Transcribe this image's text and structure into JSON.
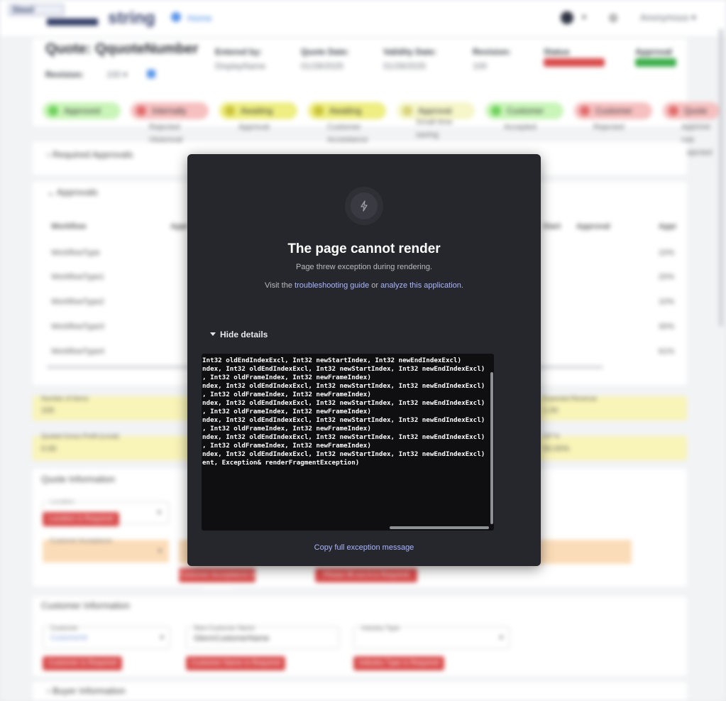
{
  "background": {
    "logo_text": "Steel",
    "brand": "string",
    "home_label": "Home",
    "user_label": "Anonymous",
    "quote_title": "Quote: QquoteNumber",
    "revision_label": "Revision:",
    "revision_value": "100",
    "fields": [
      {
        "label": "Entered by:",
        "value": "DisplayName"
      },
      {
        "label": "Quote Date:",
        "value": "01/28/2025"
      },
      {
        "label": "Validity Date:",
        "value": "01/28/2025"
      },
      {
        "label": "Revision:",
        "value": "100"
      },
      {
        "label": "Status",
        "value": ""
      },
      {
        "label": "Approval",
        "value": ""
      }
    ],
    "pills": [
      {
        "label": "Approved",
        "sub": "",
        "color": "#c9f5b8",
        "dot": "#6fcf5c"
      },
      {
        "label": "Internally",
        "sub": "Rejected (Approval Required)",
        "color": "#f7c0c0",
        "dot": "#e06a6a"
      },
      {
        "label": "Awaiting",
        "sub": "Approval",
        "color": "#eeee82",
        "dot": "#c9c23a"
      },
      {
        "label": "Awaiting",
        "sub": "Customer Acceptance",
        "color": "#eeee82",
        "dot": "#c9c23a"
      },
      {
        "label": "Approval",
        "sub": "Small time saving",
        "color": "#f6f6c9",
        "dot": "#d6d27a"
      },
      {
        "label": "Customer",
        "sub": "Accepted",
        "color": "#c9f5b8",
        "dot": "#6fcf5c"
      },
      {
        "label": "Customer",
        "sub": "Rejected",
        "color": "#f7c0c0",
        "dot": "#e06a6a"
      },
      {
        "label": "Quote",
        "sub": "Approve rule Rejected",
        "color": "#f7c0c0",
        "dot": "#e06a6a"
      }
    ],
    "sections": {
      "required_approvals": "Required Approvals",
      "approvals": "Approvals",
      "quote_information": "Quote Information",
      "customer_information": "Customer Information",
      "buyer_information": "Buyer Information"
    },
    "table": {
      "headers": [
        "Workflow",
        "Appr",
        "",
        "Start",
        "Approval",
        "Appr"
      ],
      "rows": [
        {
          "workflow": "WorkflowType",
          "right": "10%"
        },
        {
          "workflow": "WorkflowType1",
          "right": "20%"
        },
        {
          "workflow": "WorkflowType2",
          "right": "10%"
        },
        {
          "workflow": "WorkflowType3",
          "right": "30%"
        },
        {
          "workflow": "WorkflowType4",
          "right": "61%"
        }
      ]
    },
    "metrics": [
      {
        "label": "Number of Items",
        "value": "100"
      },
      {
        "label": "Expected Revenue",
        "value": "1.00"
      },
      {
        "label": "Quoted Gross Profit (Local)",
        "value": "0.00"
      },
      {
        "label": "GP %",
        "value": "50.00%"
      }
    ],
    "quote_info_fields": {
      "location_label": "Location",
      "acceptance_label": "Customer Acceptance"
    },
    "customer_fields": {
      "customer_label": "Customer",
      "customer_value": "CustomerId",
      "customer_name_label": "New Customer Name",
      "customer_name_value": "GlennCustomerName",
      "industry_label": "Industry Type"
    },
    "required_buttons": {
      "location": "Location is Required",
      "acceptance": "Customer Acceptance is Required",
      "ab": "Please fill out A is Required",
      "customer": "Customer is Required",
      "customer_name": "Customer Name is Required",
      "industry": "Industry Type is Required"
    }
  },
  "modal": {
    "title": "The page cannot render",
    "subtitle": "Page threw exception during rendering.",
    "links_prefix": "Visit the ",
    "link_troubleshooting": "troubleshooting guide",
    "links_middle": " or ",
    "link_analyze": "analyze this application",
    "links_suffix": ".",
    "hide_details": "Hide details",
    "stack_trace": "Int32 oldEndIndexExcl, Int32 newStartIndex, Int32 newEndIndexExcl)\nndex, Int32 oldEndIndexExcl, Int32 newStartIndex, Int32 newEndIndexExcl)\n, Int32 oldFrameIndex, Int32 newFrameIndex)\nndex, Int32 oldEndIndexExcl, Int32 newStartIndex, Int32 newEndIndexExcl)\n, Int32 oldFrameIndex, Int32 newFrameIndex)\nndex, Int32 oldEndIndexExcl, Int32 newStartIndex, Int32 newEndIndexExcl)\n, Int32 oldFrameIndex, Int32 newFrameIndex)\nndex, Int32 oldEndIndexExcl, Int32 newStartIndex, Int32 newEndIndexExcl)\n, Int32 oldFrameIndex, Int32 newFrameIndex)\nndex, Int32 oldEndIndexExcl, Int32 newStartIndex, Int32 newEndIndexExcl)\n, Int32 oldFrameIndex, Int32 newFrameIndex)\nndex, Int32 oldEndIndexExcl, Int32 newStartIndex, Int32 newEndIndexExcl)\nent, Exception& renderFragmentException)",
    "copy_label": "Copy full exception message",
    "icon": "bolt-icon"
  }
}
